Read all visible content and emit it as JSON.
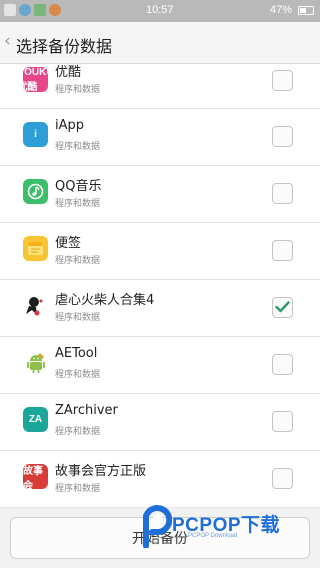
{
  "status_bar": {
    "time": "10:57",
    "battery": "47%"
  },
  "header": {
    "back_glyph": "‹",
    "title": "选择备份数据"
  },
  "apps": [
    {
      "name": "优酷",
      "subtitle": "程序和数据",
      "icon": "youku-icon",
      "icon_text": "YOUKU 优酷",
      "checked": false
    },
    {
      "name": "iApp",
      "subtitle": "程序和数据",
      "icon": "iapp-icon",
      "icon_text": "i",
      "checked": false
    },
    {
      "name": "QQ音乐",
      "subtitle": "程序和数据",
      "icon": "qq-music-icon",
      "icon_text": "",
      "checked": false
    },
    {
      "name": "便签",
      "subtitle": "程序和数据",
      "icon": "notes-icon",
      "icon_text": "",
      "checked": false
    },
    {
      "name": "虐心火柴人合集4",
      "subtitle": "程序和数据",
      "icon": "stickman-game-icon",
      "icon_text": "",
      "checked": true
    },
    {
      "name": "AETool",
      "subtitle": "程序和数据",
      "icon": "android-icon",
      "icon_text": "",
      "checked": false
    },
    {
      "name": "ZArchiver",
      "subtitle": "程序和数据",
      "icon": "zarchiver-icon",
      "icon_text": "ZA",
      "checked": false
    },
    {
      "name": "故事会官方正版",
      "subtitle": "程序和数据",
      "icon": "story-icon",
      "icon_text": "故事会",
      "checked": false
    }
  ],
  "bottom": {
    "button_label": "开始备份"
  },
  "watermark": {
    "brand": "PCPOP下载",
    "sub": "PCPOP Download"
  },
  "colors": {
    "status_bar": "#b9b9b9",
    "check_accent": "#2e9a6a",
    "watermark_blue": "#1f6fd6"
  }
}
